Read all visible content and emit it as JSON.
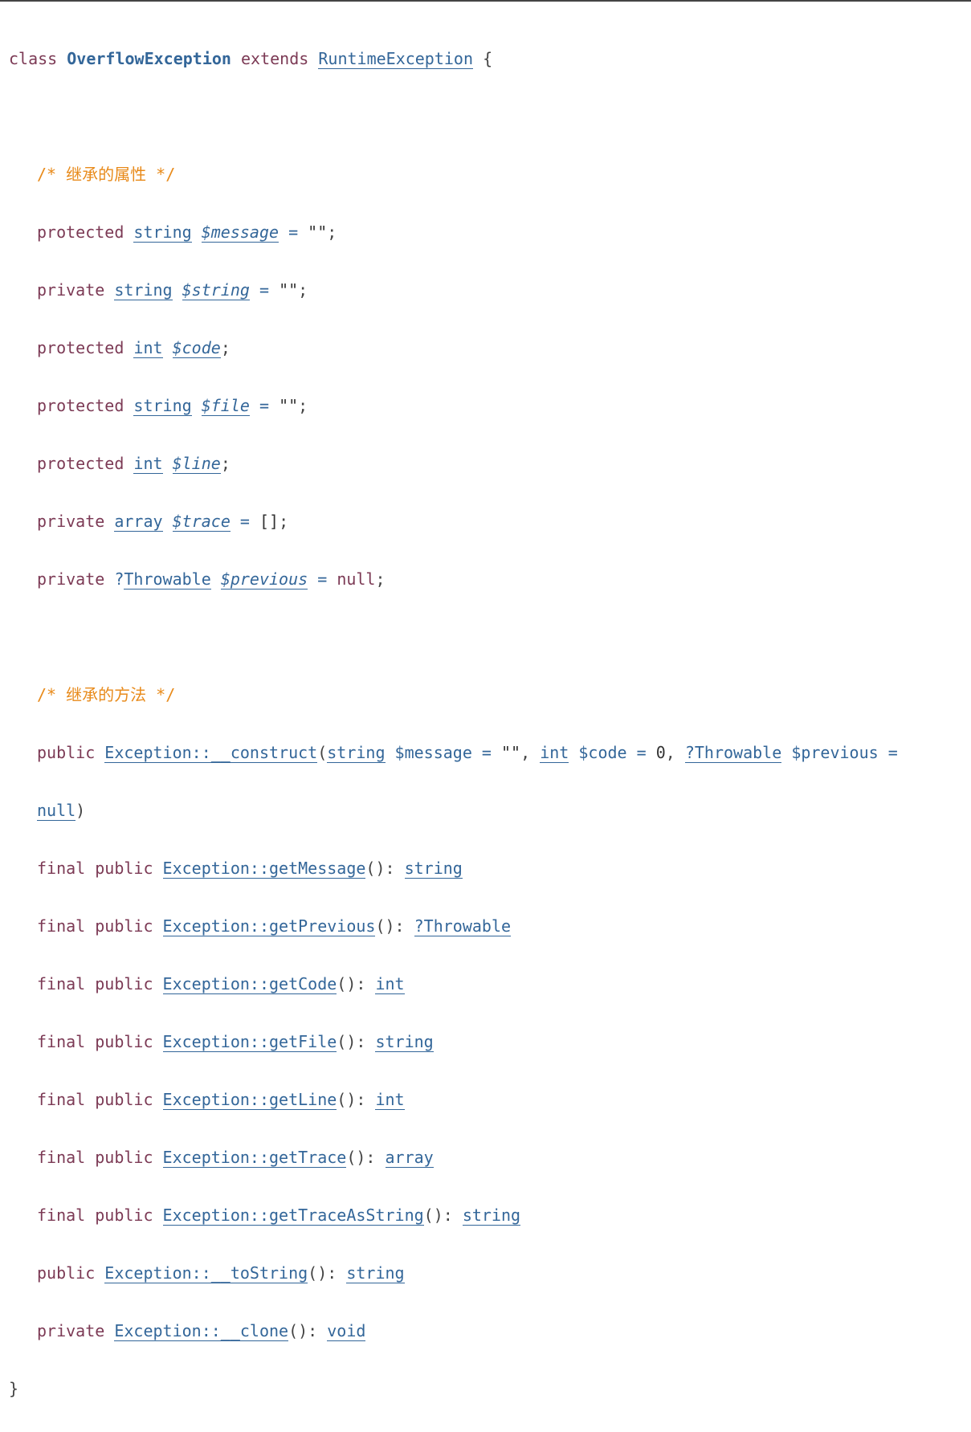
{
  "class_decl": {
    "kw_class": "class",
    "name": "OverflowException",
    "kw_extends": "extends",
    "parent": "RuntimeException",
    "open_brace": "{"
  },
  "comment_properties": "/* 继承的属性 */",
  "properties": [
    {
      "visibility": "protected",
      "type": "string",
      "name": "$message",
      "op": " = ",
      "default": "\"\"",
      "end": ";"
    },
    {
      "visibility": "private",
      "type": "string",
      "name": "$string",
      "op": " = ",
      "default": "\"\"",
      "end": ";"
    },
    {
      "visibility": "protected",
      "type": "int",
      "name": "$code",
      "op": "",
      "default": "",
      "end": ";"
    },
    {
      "visibility": "protected",
      "type": "string",
      "name": "$file",
      "op": " = ",
      "default": "\"\"",
      "end": ";"
    },
    {
      "visibility": "protected",
      "type": "int",
      "name": "$line",
      "op": "",
      "default": "",
      "end": ";"
    },
    {
      "visibility": "private",
      "type": "array",
      "name": "$trace",
      "op": " = ",
      "default": "[]",
      "end": ";"
    },
    {
      "visibility": "private",
      "type_prefix": "?",
      "type": "Throwable",
      "name": "$previous",
      "op": " = ",
      "default": "null",
      "end": ";"
    }
  ],
  "comment_methods": "/* 继承的方法 */",
  "constructor": {
    "modifiers": "public",
    "name": "Exception::__construct",
    "open": "(",
    "p1_type": "string",
    "p1_name": "$message",
    "p1_eq": " = ",
    "p1_default": "\"\"",
    "comma1": ", ",
    "p2_type": "int",
    "p2_name": "$code",
    "p2_eq": " = ",
    "p2_default": "0",
    "comma2": ", ",
    "p3_type": "?Throwable",
    "p3_name": "$previous",
    "p3_eq": " =",
    "p3_default": "null",
    "close": ")"
  },
  "methods": [
    {
      "modifiers": "final public",
      "name": "Exception::getMessage",
      "sig": "(): ",
      "ret": "string"
    },
    {
      "modifiers": "final public",
      "name": "Exception::getPrevious",
      "sig": "(): ",
      "ret": "?Throwable"
    },
    {
      "modifiers": "final public",
      "name": "Exception::getCode",
      "sig": "(): ",
      "ret": "int"
    },
    {
      "modifiers": "final public",
      "name": "Exception::getFile",
      "sig": "(): ",
      "ret": "string"
    },
    {
      "modifiers": "final public",
      "name": "Exception::getLine",
      "sig": "(): ",
      "ret": "int"
    },
    {
      "modifiers": "final public",
      "name": "Exception::getTrace",
      "sig": "(): ",
      "ret": "array"
    },
    {
      "modifiers": "final public",
      "name": "Exception::getTraceAsString",
      "sig": "(): ",
      "ret": "string"
    },
    {
      "modifiers": "public",
      "name": "Exception::__toString",
      "sig": "(): ",
      "ret": "string"
    },
    {
      "modifiers": "private",
      "name": "Exception::__clone",
      "sig": "(): ",
      "ret": "void"
    }
  ],
  "close_brace": "}"
}
